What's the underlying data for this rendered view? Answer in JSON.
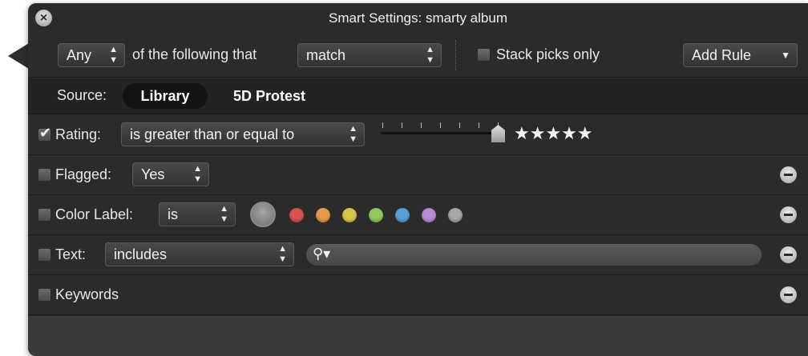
{
  "window": {
    "title": "Smart Settings: smarty album"
  },
  "criteria": {
    "match_mode": "Any",
    "middle_text": "of the following that",
    "match_type": "match",
    "stack_picks_label": "Stack picks only",
    "stack_picks_checked": false,
    "add_rule_label": "Add Rule"
  },
  "source": {
    "label": "Source:",
    "selected": "Library",
    "other": "5D Protest"
  },
  "rules": {
    "rating": {
      "checked": true,
      "label": "Rating:",
      "operator": "is greater than or equal to",
      "stars": "★★★★★",
      "value": 5,
      "max": 5
    },
    "flagged": {
      "checked": false,
      "label": "Flagged:",
      "value": "Yes"
    },
    "color_label": {
      "checked": false,
      "label": "Color Label:",
      "operator": "is",
      "colors": [
        "#d9534f",
        "#e89a4a",
        "#d9c84e",
        "#8ecb5a",
        "#5aa0d8",
        "#b98ad6",
        "#a8a8a8"
      ]
    },
    "text": {
      "checked": false,
      "label": "Text:",
      "operator": "includes",
      "search_value": ""
    },
    "keywords": {
      "checked": false,
      "label": "Keywords"
    }
  }
}
